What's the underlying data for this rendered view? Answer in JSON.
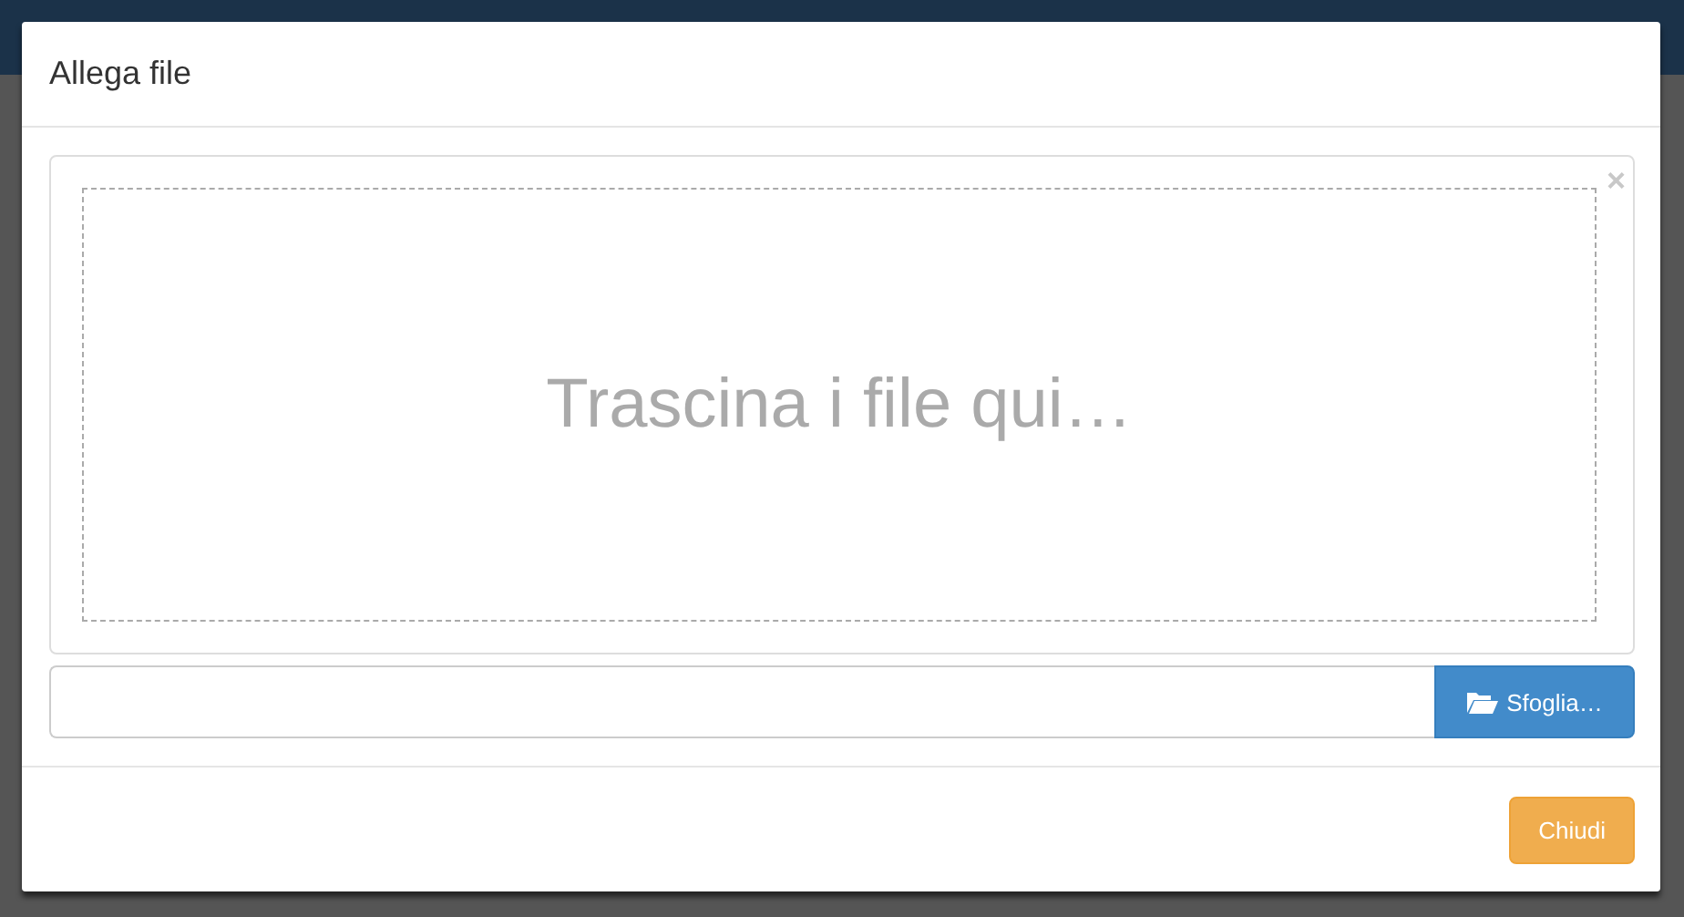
{
  "dialog": {
    "title": "Allega file"
  },
  "dropzone": {
    "close_symbol": "×",
    "prompt": "Trascina i file qui…"
  },
  "file_field": {
    "button": "Sfoglia…"
  },
  "footer": {
    "buttons": [
      {
        "label": "Chiudi",
        "kind": "warning"
      }
    ]
  }
}
